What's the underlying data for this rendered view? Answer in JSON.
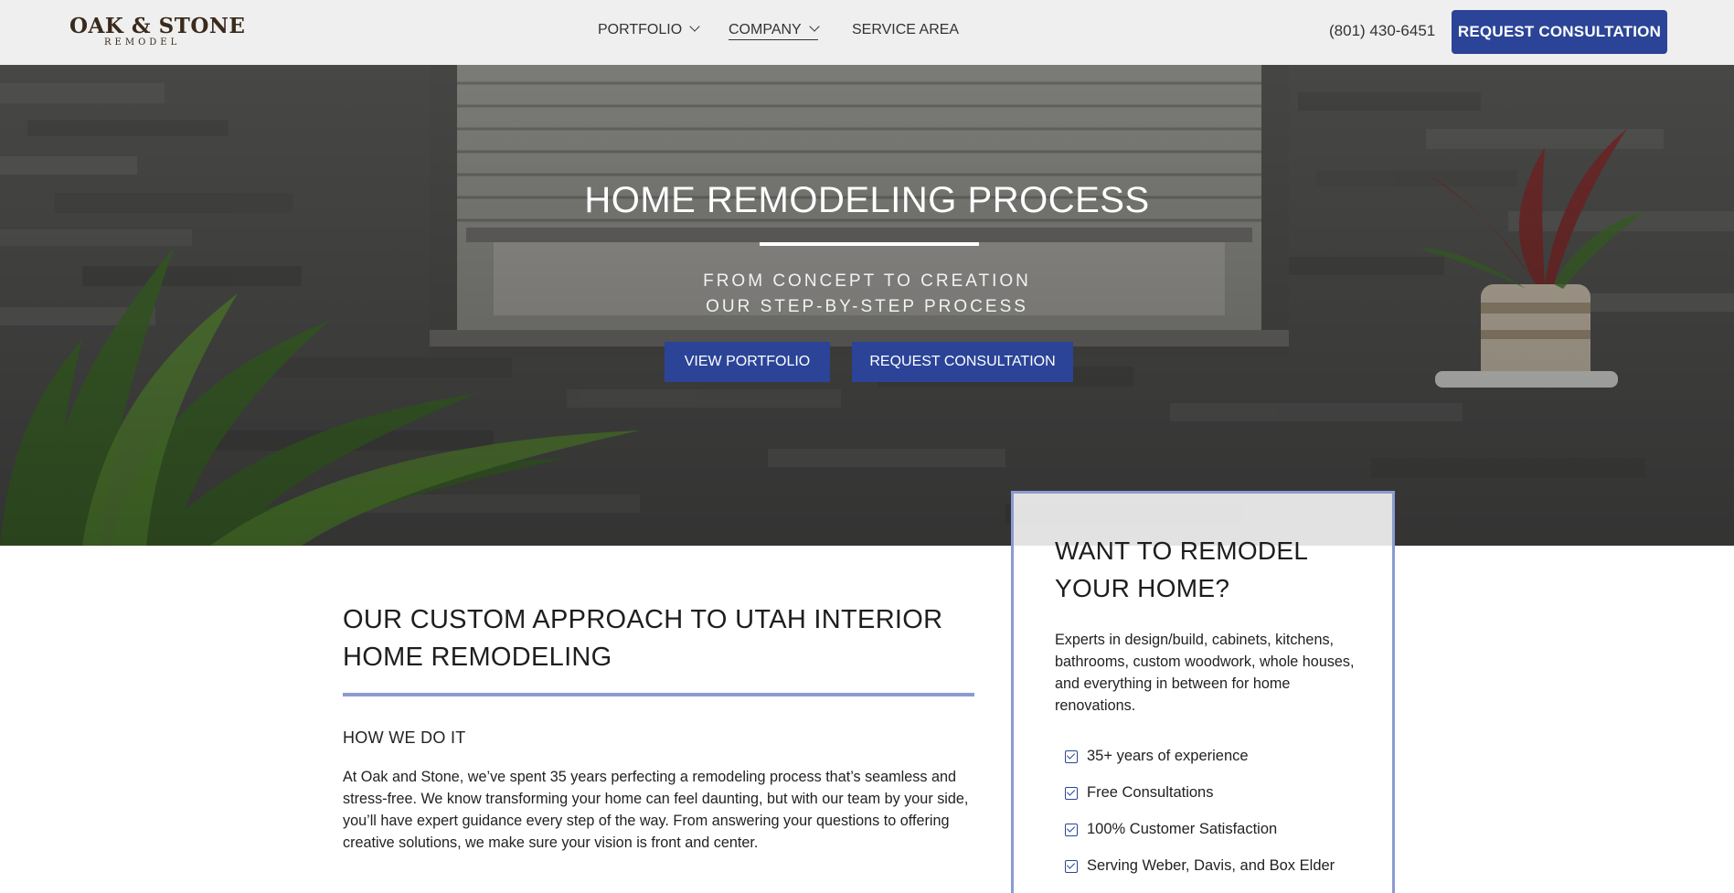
{
  "header": {
    "logo_main": "OAK & STONE",
    "logo_sub": "REMODEL",
    "nav": [
      {
        "label": "PORTFOLIO"
      },
      {
        "label": "COMPANY"
      },
      {
        "label": "SERVICE AREA"
      }
    ],
    "phone": "(801) 430-6451",
    "cta": "REQUEST CONSULTATION"
  },
  "hero": {
    "title": "HOME REMODELING PROCESS",
    "subtitle_line1": "FROM CONCEPT TO CREATION",
    "subtitle_line2": "OUR STEP-BY-STEP PROCESS",
    "btn_portfolio": "VIEW PORTFOLIO",
    "btn_consult": "REQUEST CONSULTATION"
  },
  "main": {
    "title": "OUR CUSTOM APPROACH TO UTAH INTERIOR HOME REMODELING",
    "subhead": "HOW WE DO IT",
    "paragraph": "At Oak and Stone, we’ve spent 35 years perfecting a remodeling process that’s seamless and stress-free. We know transforming your home can feel daunting, but with our team by your side, you’ll have expert guidance every step of the way. From answering your questions to offering creative solutions, we make sure your vision is front and center."
  },
  "sidebar": {
    "title": "WANT TO REMODEL YOUR HOME?",
    "text": "Experts in design/build, cabinets, kitchens, bathrooms, custom woodwork, whole houses, and everything in between for home renovations.",
    "checklist": [
      "35+ years of experience",
      "Free Consultations",
      "100% Customer Satisfaction",
      "Serving Weber, Davis, and Box Elder"
    ]
  },
  "colors": {
    "accent": "#2b4497",
    "rule": "#8a9bd0",
    "header_bg": "#efefef"
  }
}
